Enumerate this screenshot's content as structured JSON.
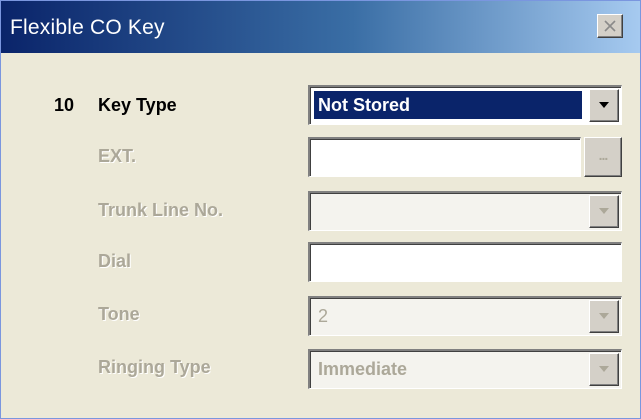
{
  "window": {
    "title": "Flexible CO Key",
    "close_icon": "close-icon"
  },
  "form": {
    "row_number": "10",
    "fields": [
      {
        "label": "Key Type",
        "value": "Not Stored",
        "enabled": true,
        "kind": "combo"
      },
      {
        "label": "EXT.",
        "value": "",
        "enabled": false,
        "kind": "text-browse",
        "browse_label": "..."
      },
      {
        "label": "Trunk Line No.",
        "value": "",
        "enabled": false,
        "kind": "combo"
      },
      {
        "label": "Dial",
        "value": "",
        "enabled": false,
        "kind": "text"
      },
      {
        "label": "Tone",
        "value": "2",
        "enabled": false,
        "kind": "combo"
      },
      {
        "label": "Ringing Type",
        "value": "Immediate",
        "enabled": false,
        "kind": "combo"
      }
    ]
  },
  "colors": {
    "title_gradient_start": "#0a246a",
    "title_gradient_end": "#a6caf0",
    "selection": "#0a246a",
    "disabled_text": "#aca899",
    "dialog_bg": "#ece9d8"
  }
}
